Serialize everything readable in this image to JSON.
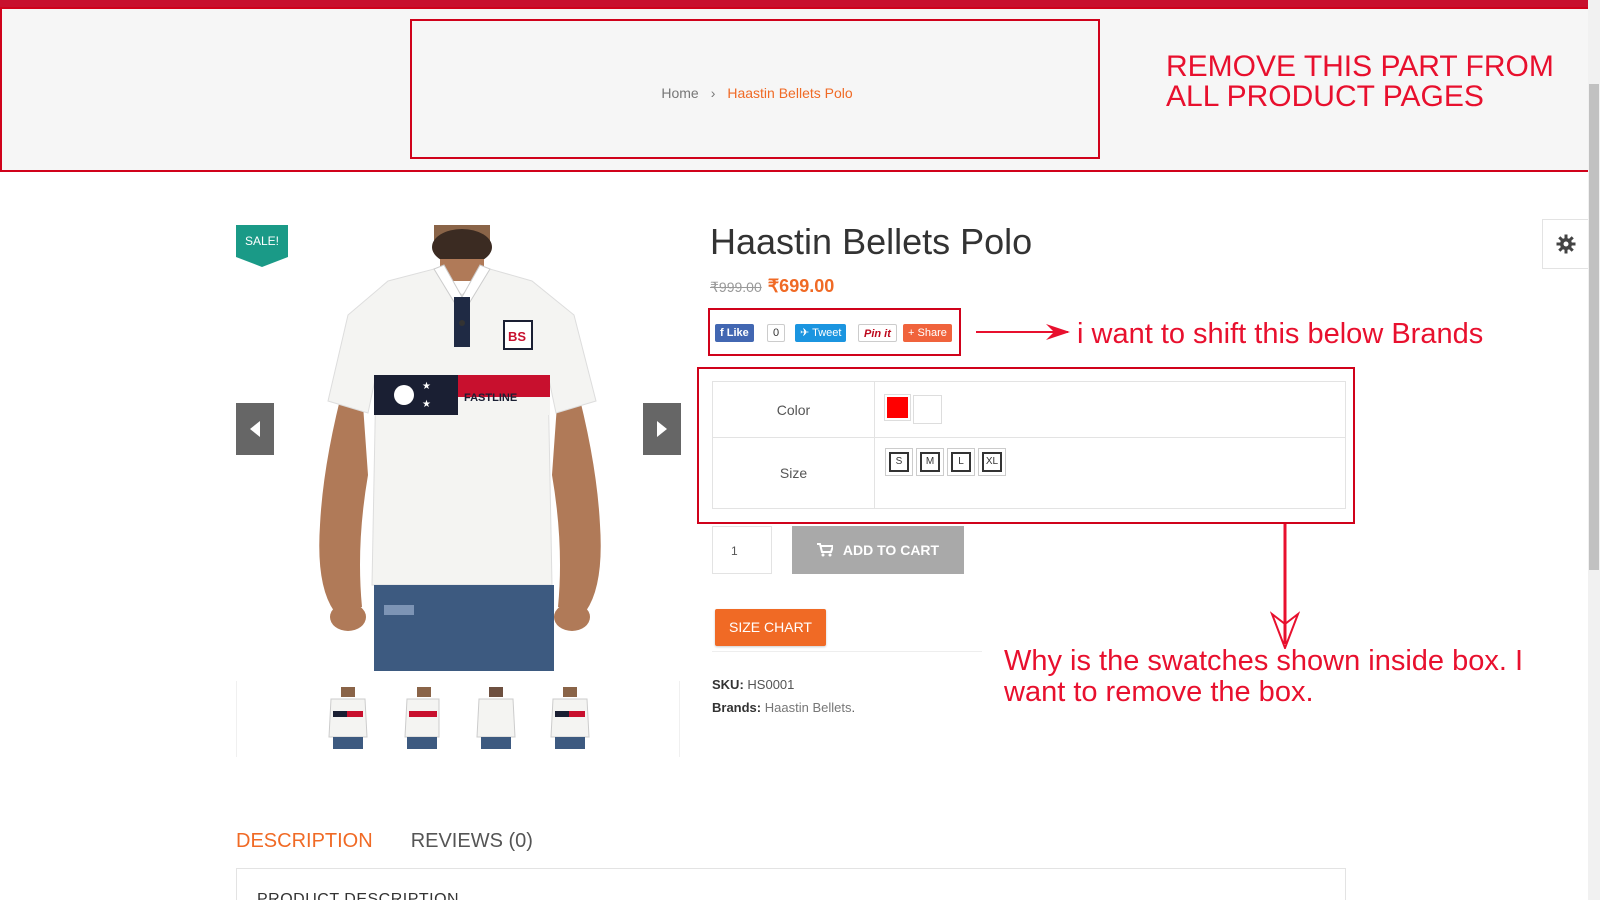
{
  "breadcrumb": {
    "home": "Home",
    "separator": "›",
    "current": "Haastin Bellets Polo"
  },
  "annotations": {
    "remove": "REMOVE THIS PART FROM ALL PRODUCT PAGES",
    "shift": "i want to shift this below Brands",
    "swatches": "Why is the swatches shown inside box. I want to remove the box."
  },
  "product": {
    "sale_badge": "SALE!",
    "title": "Haastin Bellets Polo",
    "price_old": "₹999.00",
    "price_new": "₹699.00",
    "shirt_print": "FASTLINE",
    "shirt_logo": "BS"
  },
  "social": {
    "like": "Like",
    "like_count": "0",
    "tweet": "Tweet",
    "pin": "Pin it",
    "share": "Share"
  },
  "variations": {
    "color_label": "Color",
    "size_label": "Size",
    "colors": [
      "#ff0000",
      "#ffffff"
    ],
    "sizes": [
      "S",
      "M",
      "L",
      "XL"
    ]
  },
  "cart": {
    "quantity": "1",
    "add_to_cart": "ADD TO CART",
    "size_chart": "SIZE CHART"
  },
  "meta": {
    "sku_label": "SKU:",
    "sku": "HS0001",
    "brands_label": "Brands:",
    "brand": "Haastin Bellets",
    "brand_suffix": "."
  },
  "tabs": [
    {
      "label": "DESCRIPTION",
      "active": true
    },
    {
      "label": "REVIEWS (0)",
      "active": false
    }
  ],
  "description_heading": "PRODUCT DESCRIPTION",
  "colors": {
    "accent": "#f06a25",
    "sale": "#1a9a87",
    "annotation": "#e8102e"
  },
  "icons": [
    "chevron-left-icon",
    "chevron-right-icon",
    "cart-icon",
    "gear-icon",
    "facebook-icon",
    "twitter-icon",
    "pinterest-icon"
  ]
}
